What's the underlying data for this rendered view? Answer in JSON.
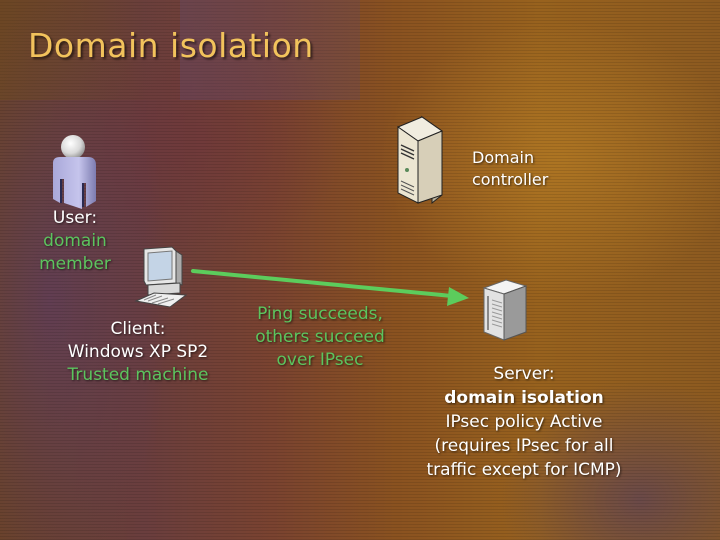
{
  "slide": {
    "title": "Domain isolation"
  },
  "nodes": {
    "user": {
      "icon": "user-icon",
      "label": "User:",
      "role_line1": "domain",
      "role_line2": "member"
    },
    "domain_controller": {
      "icon": "tower-server-icon",
      "line1": "Domain",
      "line2": "controller"
    },
    "client": {
      "icon": "desktop-computer-icon",
      "label": "Client:",
      "os": "Windows XP SP2",
      "status": "Trusted machine"
    },
    "server": {
      "icon": "server-icon",
      "label": "Server:",
      "policy_name": "domain isolation",
      "policy_state": "IPsec policy Active",
      "note_line1": "(requires IPsec for all",
      "note_line2": "traffic except for ICMP)"
    }
  },
  "connection": {
    "from": "client",
    "to": "server",
    "color": "#5ccc5c",
    "line1": "Ping succeeds,",
    "line2": "others succeed",
    "line3": "over IPsec"
  },
  "colors": {
    "title": "#f2c35c",
    "accent_green": "#5cc45e",
    "text": "#ffffff"
  }
}
